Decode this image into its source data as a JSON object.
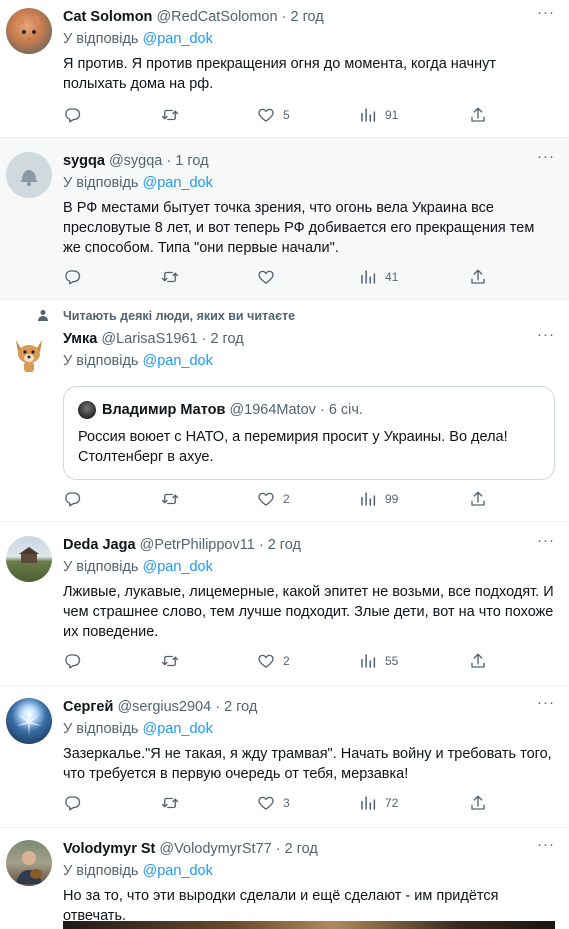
{
  "reply_prefix": "У відповідь",
  "tweets": [
    {
      "name": "Cat Solomon",
      "handle": "@RedCatSolomon",
      "dot": "·",
      "time": "2 год",
      "reply_to": "@pan_dok",
      "text": "Я против. Я против прекращения огня до момента, когда начнут полыхать дома на рф.",
      "likes": "5",
      "views": "91"
    },
    {
      "name": "sygqa",
      "handle": "@sygqa",
      "dot": "·",
      "time": "1 год",
      "reply_to": "@pan_dok",
      "text": "В РФ местами бытует точка зрения, что огонь вела Украина все пресловутые 8 лет, и вот теперь РФ  добивается его прекращения тем же способом. Типа \"они первые начали\".",
      "likes": "",
      "views": "41"
    },
    {
      "social_context": "Читають деякі люди, яких ви читаєте",
      "name": "Умка",
      "handle": "@LarisaS1961",
      "dot": "·",
      "time": "2 год",
      "reply_to": "@pan_dok",
      "quote": {
        "name": "Владимир Матов",
        "handle": "@1964Matov",
        "dot": "·",
        "time": "6 січ.",
        "text": "Россия воюет с НАТО, а перемирия просит у Украины. Во дела! Столтенберг в ахуе."
      },
      "likes": "2",
      "views": "99"
    },
    {
      "name": "Deda Jaga",
      "handle": "@PetrPhilippov11",
      "dot": "·",
      "time": "2 год",
      "reply_to": "@pan_dok",
      "text": "Лживые, лукавые, лицемерные, какой эпитет не возьми, все подходят. И чем страшнее слово, тем лучше подходит. Злые дети, вот на что похоже их поведение.",
      "likes": "2",
      "views": "55"
    },
    {
      "name": "Сергей",
      "handle": "@sergius2904",
      "dot": "·",
      "time": "2 год",
      "reply_to": "@pan_dok",
      "text": "Зазеркалье.\"Я не такая, я жду трамвая\". Начать войну и требовать того, что требуется в первую очередь от тебя, мерзавка!",
      "likes": "3",
      "views": "72"
    },
    {
      "name": "Volodymyr St",
      "handle": "@VolodymyrSt77",
      "dot": "·",
      "time": "2 год",
      "reply_to": "@pan_dok",
      "text": "Но за то, что эти выродки сделали и ещё сделают - им придётся отвечать."
    }
  ],
  "icons": [
    "reply-icon",
    "retweet-icon",
    "like-icon",
    "views-icon",
    "share-icon",
    "more-icon",
    "person-icon"
  ]
}
